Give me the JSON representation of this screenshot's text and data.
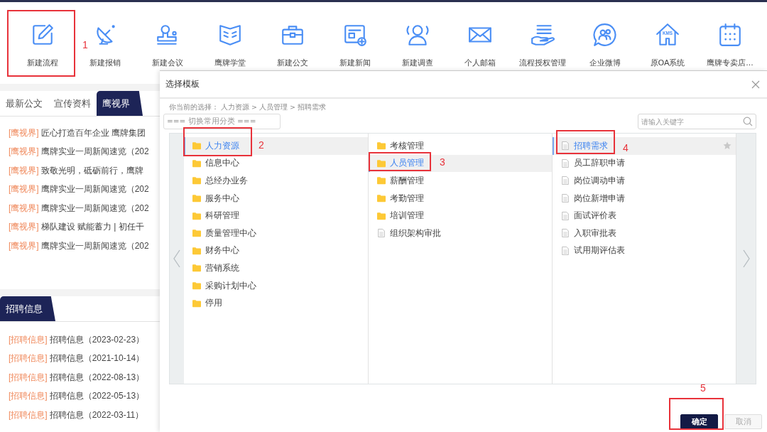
{
  "toolbar": [
    {
      "label": "新建流程"
    },
    {
      "label": "新建报销"
    },
    {
      "label": "新建会议"
    },
    {
      "label": "鹰牌学堂"
    },
    {
      "label": "新建公文"
    },
    {
      "label": "新建新闻"
    },
    {
      "label": "新建调查"
    },
    {
      "label": "个人邮箱"
    },
    {
      "label": "流程授权管理"
    },
    {
      "label": "企业微博"
    },
    {
      "label": "原OA系统",
      "icon_text": "KMS"
    },
    {
      "label": "鹰牌专卖店..."
    }
  ],
  "news_tabs": [
    {
      "label": "最新公文",
      "selected": false
    },
    {
      "label": "宣传资料",
      "selected": false
    },
    {
      "label": "鹰视界",
      "selected": true
    }
  ],
  "news": [
    {
      "tag": "[鹰视界]",
      "title": "匠心打造百年企业 鹰牌集团"
    },
    {
      "tag": "[鹰视界]",
      "title": "鹰牌实业一周新闻速览（202"
    },
    {
      "tag": "[鹰视界]",
      "title": "致敬光明，砥砺前行，鹰牌"
    },
    {
      "tag": "[鹰视界]",
      "title": "鹰牌实业一周新闻速览（202"
    },
    {
      "tag": "[鹰视界]",
      "title": "鹰牌实业一周新闻速览（202"
    },
    {
      "tag": "[鹰视界]",
      "title": "梯队建设 赋能蓄力 | 初任干"
    },
    {
      "tag": "[鹰视界]",
      "title": "鹰牌实业一周新闻速览（202"
    }
  ],
  "recruit_tab": {
    "label": "招聘信息"
  },
  "recruit": [
    {
      "tag": "[招聘信息]",
      "title": "招聘信息（2023-02-23）"
    },
    {
      "tag": "[招聘信息]",
      "title": "招聘信息（2021-10-14）"
    },
    {
      "tag": "[招聘信息]",
      "title": "招聘信息（2022-08-13）"
    },
    {
      "tag": "[招聘信息]",
      "title": "招聘信息（2022-05-13）"
    },
    {
      "tag": "[招聘信息]",
      "title": "招聘信息（2022-03-11）"
    }
  ],
  "dialog": {
    "title": "选择模板",
    "breadcrumb": "你当前的选择： 人力资源 > 人员管理 > 招聘需求",
    "category_select": "=== 切换常用分类 ===",
    "search_placeholder": "请输入关键字",
    "columns": [
      [
        {
          "label": "人力资源",
          "kind": "folder",
          "selected": true,
          "star": false
        },
        {
          "label": "信息中心",
          "kind": "folder",
          "selected": false,
          "star": false
        },
        {
          "label": "总经办业务",
          "kind": "folder",
          "selected": false,
          "star": false
        },
        {
          "label": "服务中心",
          "kind": "folder",
          "selected": false,
          "star": false
        },
        {
          "label": "科研管理",
          "kind": "folder",
          "selected": false,
          "star": false
        },
        {
          "label": "质量管理中心",
          "kind": "folder",
          "selected": false,
          "star": false
        },
        {
          "label": "财务中心",
          "kind": "folder",
          "selected": false,
          "star": false
        },
        {
          "label": "营销系统",
          "kind": "folder",
          "selected": false,
          "star": false
        },
        {
          "label": "采购计划中心",
          "kind": "folder",
          "selected": false,
          "star": false
        },
        {
          "label": "停用",
          "kind": "folder",
          "selected": false,
          "star": false
        }
      ],
      [
        {
          "label": "考核管理",
          "kind": "folder",
          "selected": false,
          "star": false
        },
        {
          "label": "人员管理",
          "kind": "folder",
          "selected": true,
          "star": false
        },
        {
          "label": "薪酬管理",
          "kind": "folder",
          "selected": false,
          "star": false
        },
        {
          "label": "考勤管理",
          "kind": "folder",
          "selected": false,
          "star": false
        },
        {
          "label": "培训管理",
          "kind": "folder",
          "selected": false,
          "star": false
        },
        {
          "label": "组织架构审批",
          "kind": "document",
          "selected": false,
          "star": false
        }
      ],
      [
        {
          "label": "招聘需求",
          "kind": "document",
          "selected": true,
          "star": true
        },
        {
          "label": "员工辞职申请",
          "kind": "document",
          "selected": false,
          "star": false
        },
        {
          "label": "岗位调动申请",
          "kind": "document",
          "selected": false,
          "star": false
        },
        {
          "label": "岗位新增申请",
          "kind": "document",
          "selected": false,
          "star": false
        },
        {
          "label": "面试评价表",
          "kind": "document",
          "selected": false,
          "star": false
        },
        {
          "label": "入职审批表",
          "kind": "document",
          "selected": false,
          "star": false
        },
        {
          "label": "试用期评估表",
          "kind": "document",
          "selected": false,
          "star": false
        }
      ]
    ],
    "buttons": [
      {
        "label": "确定",
        "kind": "primary"
      },
      {
        "label": "取消",
        "kind": "disabled"
      }
    ]
  },
  "annotations": [
    {
      "number": "1"
    },
    {
      "number": "2"
    },
    {
      "number": "3"
    },
    {
      "number": "4"
    },
    {
      "number": "5"
    }
  ]
}
